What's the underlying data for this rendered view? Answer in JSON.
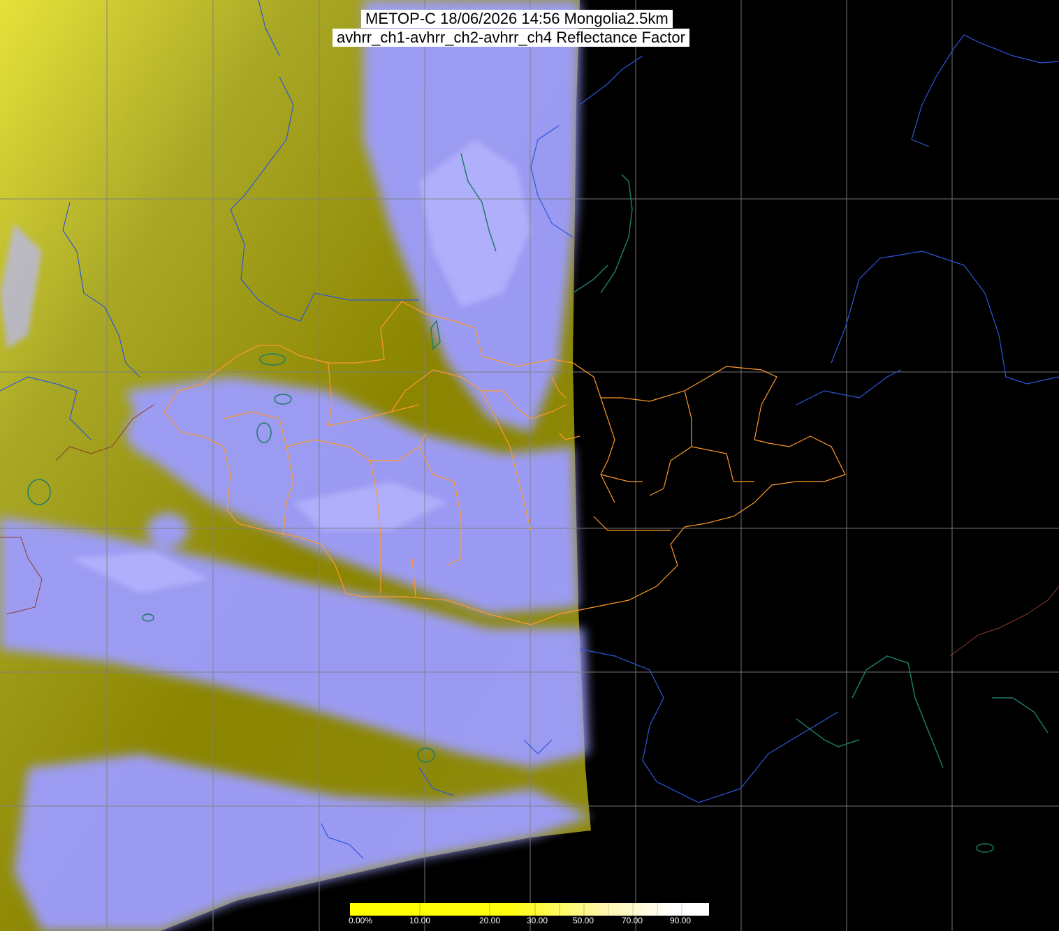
{
  "title": {
    "line1": "METOP-C 18/06/2026 14:56 Mongolia2.5km",
    "line2": "avhrr_ch1-avhrr_ch2-avhrr_ch4 Reflectance Factor"
  },
  "colorbar": {
    "labels": [
      "0.00%",
      "10.00",
      "20.00",
      "30.00",
      "50.00",
      "70.00",
      "90.00"
    ],
    "colors": [
      "#ffff00",
      "#fffde0",
      "#ffffff"
    ]
  },
  "colors": {
    "cloud": "#9c9cff",
    "land": "#8f8a00",
    "desert": "#b0b030",
    "no_data": "#000000",
    "border_country": "#ff9a2a",
    "coastline": "#2f57d8",
    "lakes": "#1f7a6a",
    "grid": "#808080"
  }
}
